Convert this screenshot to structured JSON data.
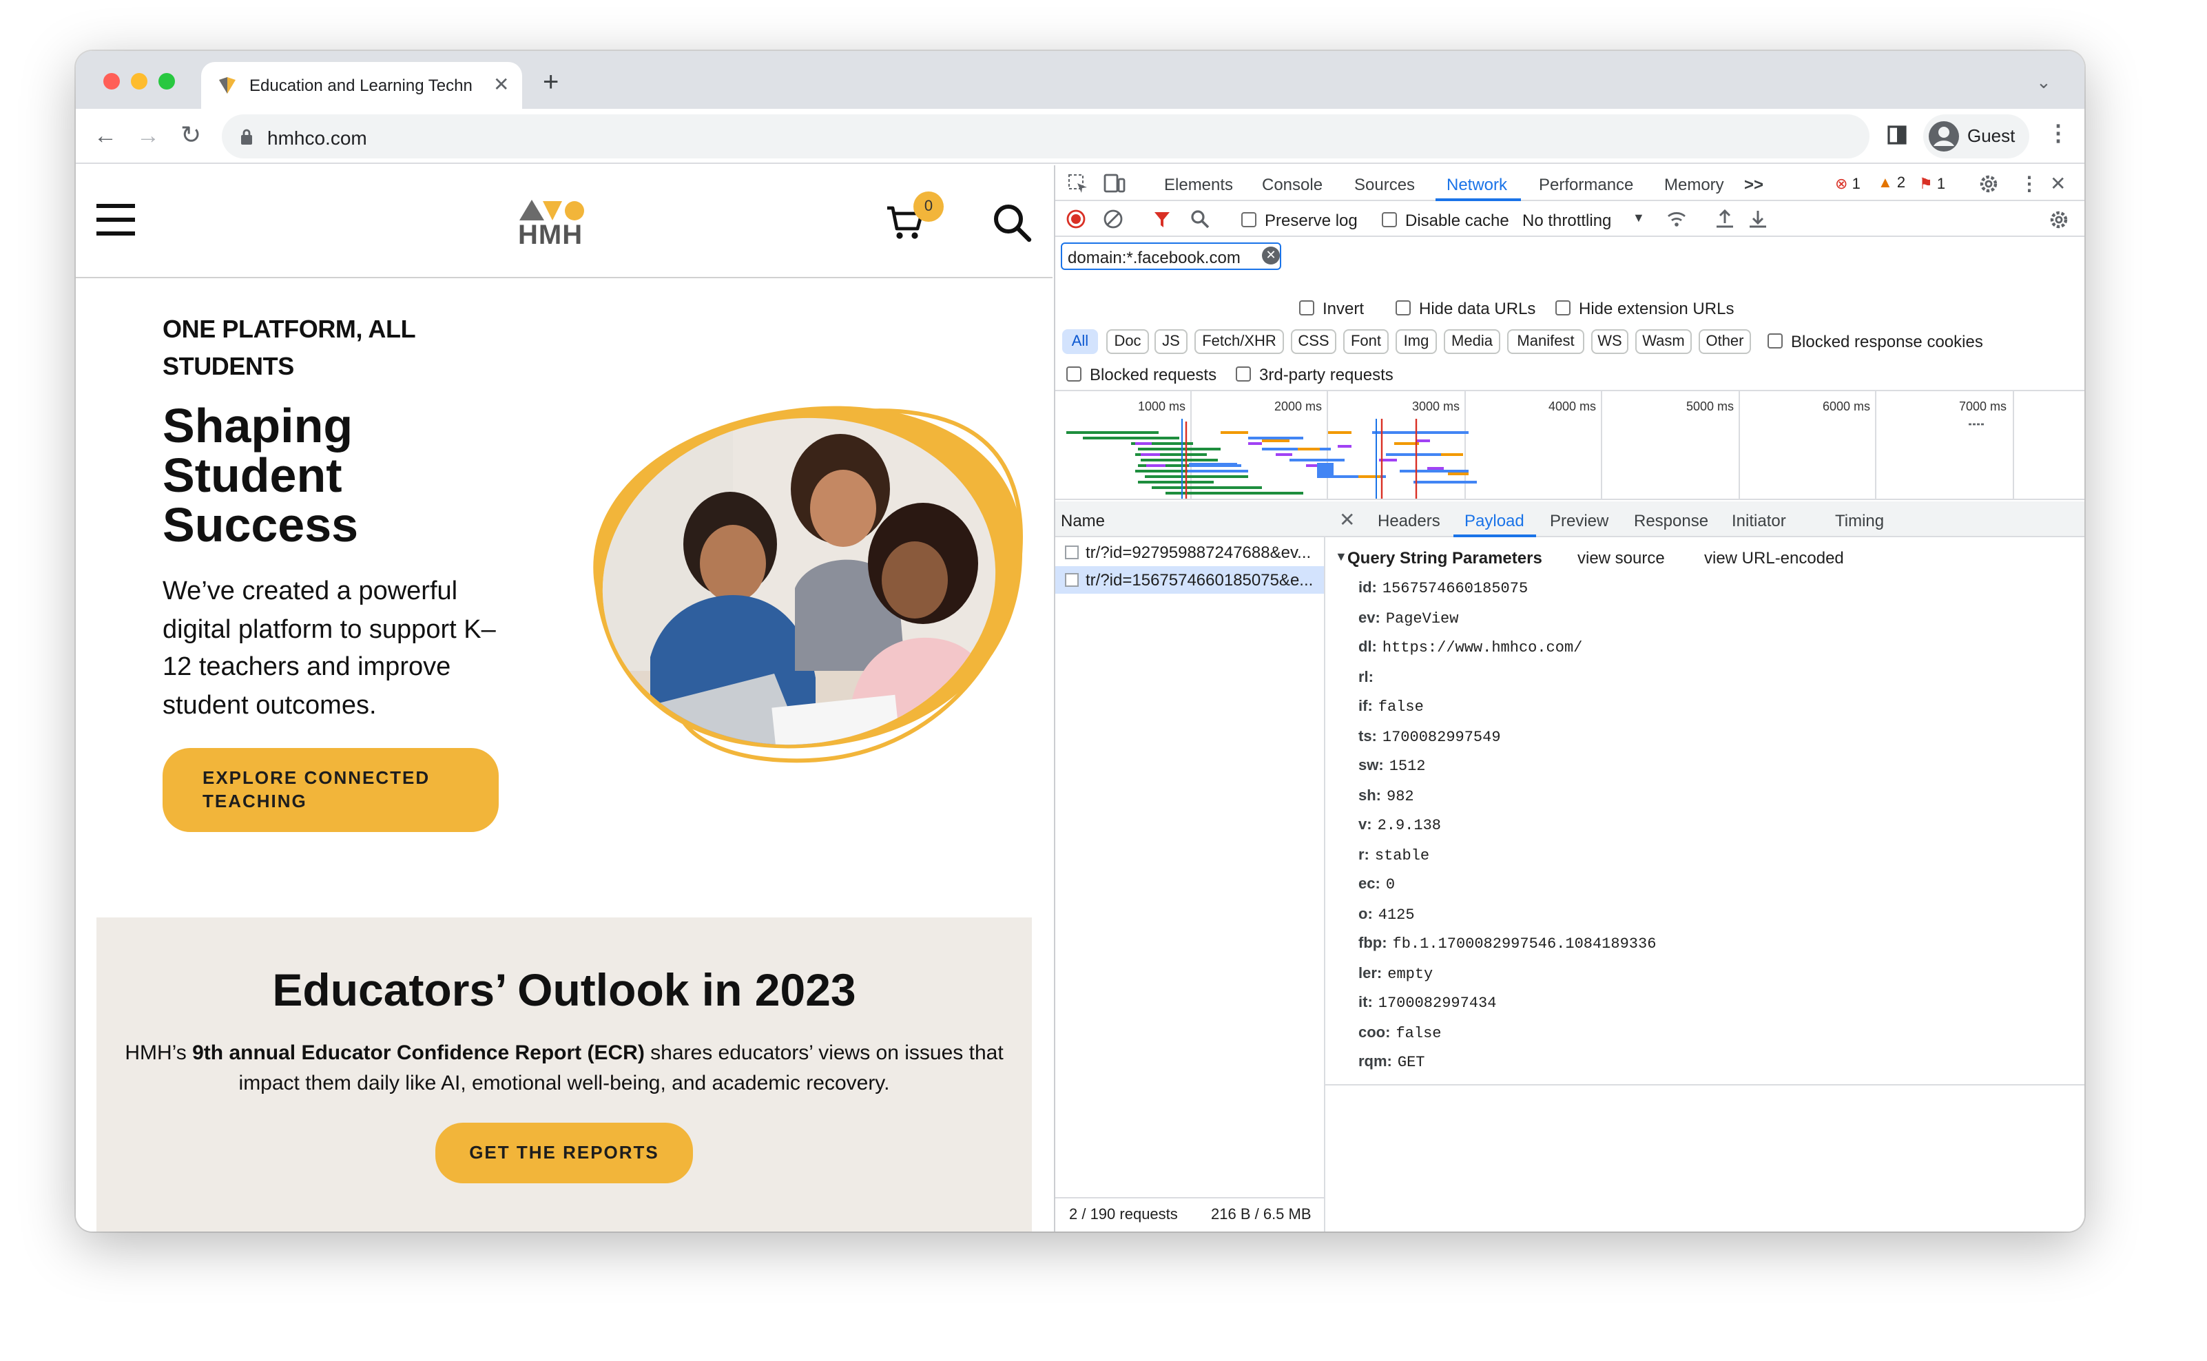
{
  "browser": {
    "tab_title": "Education and Learning Techn",
    "address": "hmhco.com",
    "profile_label": "Guest"
  },
  "site": {
    "logo_text": "HMH",
    "cart_count": "0",
    "eyebrow": "ONE PLATFORM, ALL STUDENTS",
    "headline": "Shaping Student Success",
    "lead": "We’ve created a powerful digital platform to support K–12 teachers and improve student outcomes.",
    "cta_label": "EXPLORE CONNECTED TEACHING",
    "promo_title": "Educators’ Outlook in 2023",
    "promo_prefix": "HMH’s ",
    "promo_bold": "9th annual Educator Confidence Report (ECR)",
    "promo_suffix": " shares educators’ views on issues that impact them daily like AI, emotional well-being, and academic recovery.",
    "promo_cta_label": "GET THE REPORTS"
  },
  "devtools": {
    "tabs": [
      "Elements",
      "Console",
      "Sources",
      "Network",
      "Performance",
      "Memory"
    ],
    "more_tabs": ">>",
    "errors": "1",
    "warnings": "2",
    "issues": "1",
    "preserve_log": "Preserve log",
    "disable_cache": "Disable cache",
    "throttling": "No throttling",
    "filter_value": "domain:*.facebook.com",
    "invert": "Invert",
    "hide_data_urls": "Hide data URLs",
    "hide_extension_urls": "Hide extension URLs",
    "type_filters": [
      "All",
      "Doc",
      "JS",
      "Fetch/XHR",
      "CSS",
      "Font",
      "Img",
      "Media",
      "Manifest",
      "WS",
      "Wasm",
      "Other"
    ],
    "blocked_response_cookies": "Blocked response cookies",
    "blocked_requests": "Blocked requests",
    "third_party": "3rd-party requests",
    "timeline_labels": [
      "1000 ms",
      "2000 ms",
      "3000 ms",
      "4000 ms",
      "5000 ms",
      "6000 ms",
      "7000 ms"
    ],
    "name_header": "Name",
    "requests": [
      "tr/?id=927959887247688&ev...",
      "tr/?id=1567574660185075&e..."
    ],
    "detail_tabs": [
      "Headers",
      "Payload",
      "Preview",
      "Response",
      "Initiator",
      "Timing"
    ],
    "section_title": "Query String Parameters",
    "view_source": "view source",
    "view_url_encoded": "view URL-encoded",
    "params": [
      {
        "k": "id:",
        "v": "1567574660185075"
      },
      {
        "k": "ev:",
        "v": "PageView"
      },
      {
        "k": "dl:",
        "v": "https://www.hmhco.com/"
      },
      {
        "k": "rl:",
        "v": ""
      },
      {
        "k": "if:",
        "v": "false"
      },
      {
        "k": "ts:",
        "v": "1700082997549"
      },
      {
        "k": "sw:",
        "v": "1512"
      },
      {
        "k": "sh:",
        "v": "982"
      },
      {
        "k": "v:",
        "v": "2.9.138"
      },
      {
        "k": "r:",
        "v": "stable"
      },
      {
        "k": "ec:",
        "v": "0"
      },
      {
        "k": "o:",
        "v": "4125"
      },
      {
        "k": "fbp:",
        "v": "fb.1.1700082997546.1084189336"
      },
      {
        "k": "ler:",
        "v": "empty"
      },
      {
        "k": "it:",
        "v": "1700082997434"
      },
      {
        "k": "coo:",
        "v": "false"
      },
      {
        "k": "rqm:",
        "v": "GET"
      }
    ],
    "status_requests": "2 / 190 requests",
    "status_size": "216 B / 6.5 MB"
  },
  "colors": {
    "accent": "#f2b53a",
    "devtools_blue": "#1a73e8",
    "promo_bg": "#efebe6"
  }
}
